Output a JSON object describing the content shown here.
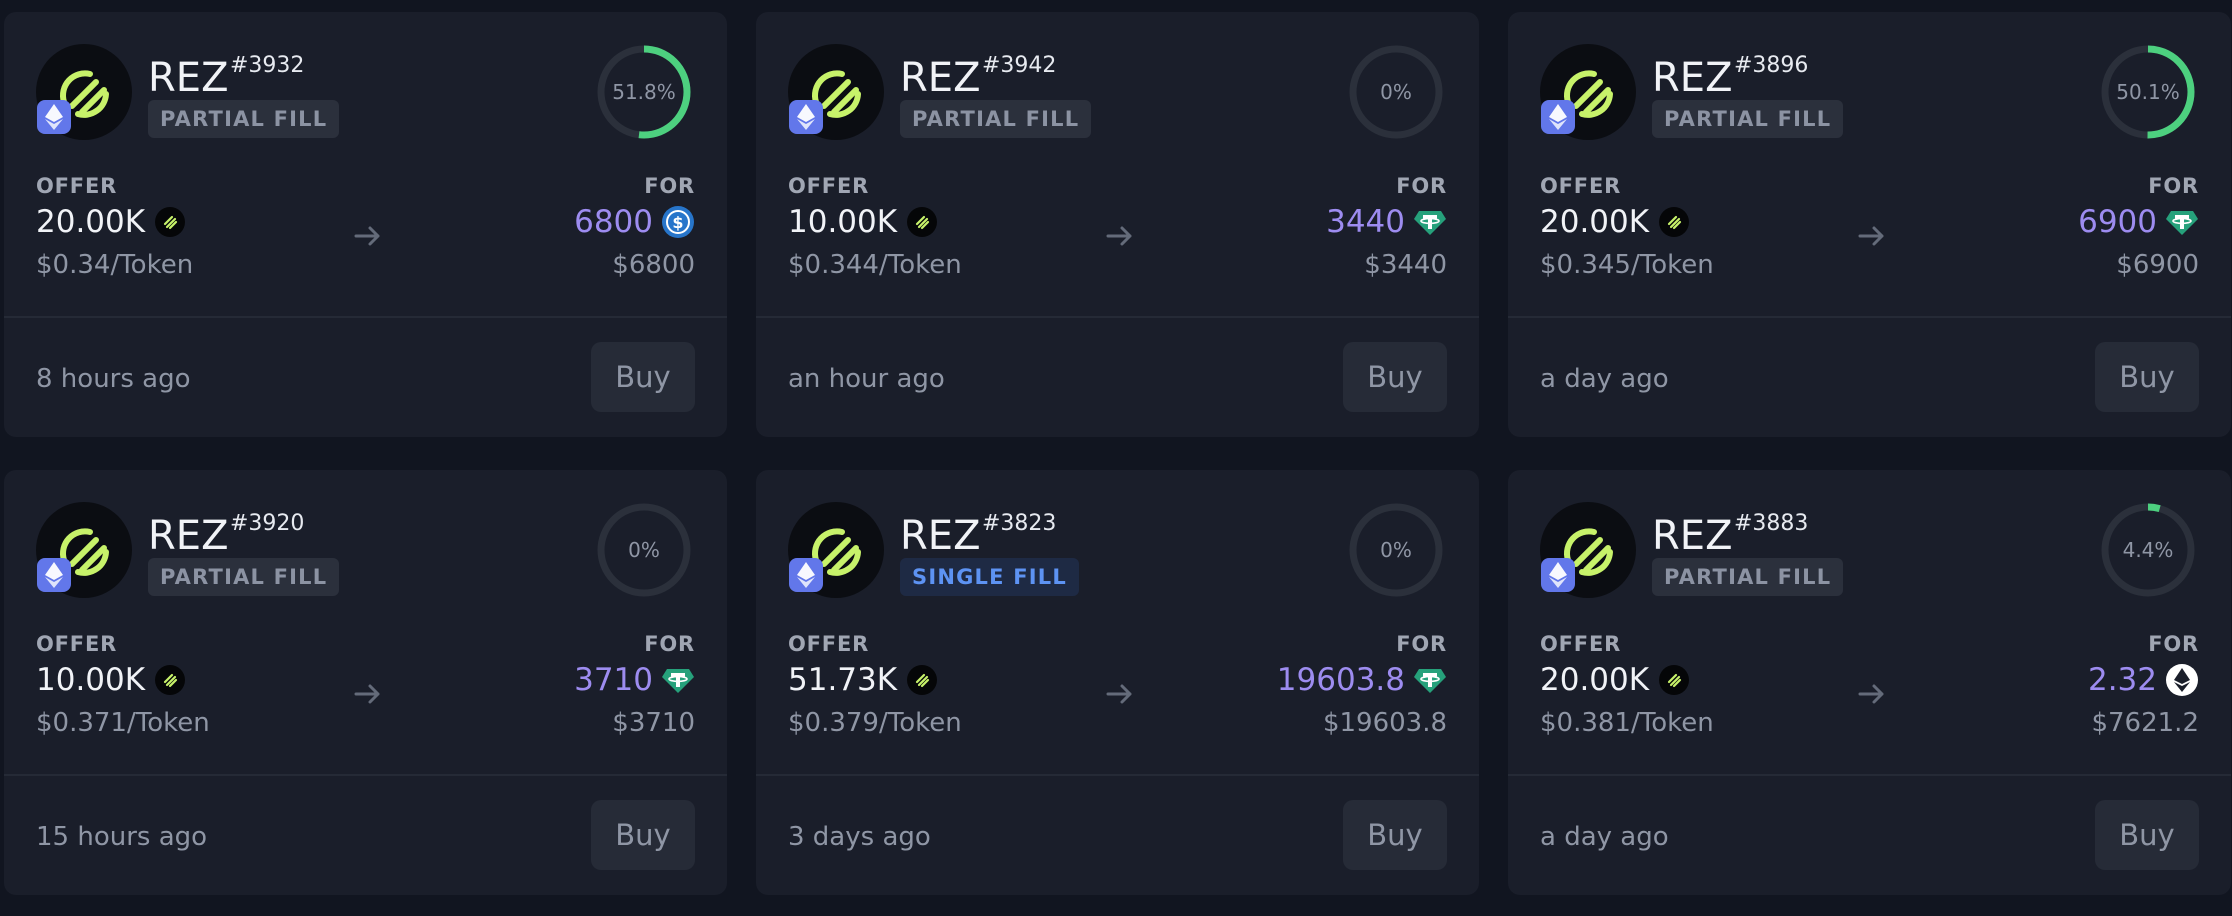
{
  "colors": {
    "background": "#111520",
    "card": "#1a1e2a",
    "accent_price": "#9d8cf0",
    "progress": "#4dd07f",
    "ring_track": "#2b303b",
    "rez_brand": "#c7f26a",
    "eth_chain": "#6277ea",
    "usdc": "#2775ca",
    "usdt": "#26a17b"
  },
  "labels": {
    "offer": "OFFER",
    "for": "FOR",
    "buy": "Buy",
    "per_token_suffix": "/Token"
  },
  "cards": [
    {
      "name": "REZ",
      "id": "#3932",
      "fill_type": "PARTIAL FILL",
      "fill_style": "partial",
      "progress": 51.8,
      "progress_label": "51.8%",
      "chain_icon": "ethereum-icon",
      "offer_amount": "20.00K",
      "offer_token_icon": "rez-token-icon",
      "price_per_token": "$0.34",
      "per_token_suffix": "/Token",
      "for_amount": "6800",
      "for_token": "usdc-icon",
      "for_usd": "$6800",
      "time": "8 hours ago",
      "buy_label": "Buy"
    },
    {
      "name": "REZ",
      "id": "#3942",
      "fill_type": "PARTIAL FILL",
      "fill_style": "partial",
      "progress": 0,
      "progress_label": "0%",
      "chain_icon": "ethereum-icon",
      "offer_amount": "10.00K",
      "offer_token_icon": "rez-token-icon",
      "price_per_token": "$0.344",
      "per_token_suffix": "/Token",
      "for_amount": "3440",
      "for_token": "usdt-icon",
      "for_usd": "$3440",
      "time": "an hour ago",
      "buy_label": "Buy"
    },
    {
      "name": "REZ",
      "id": "#3896",
      "fill_type": "PARTIAL FILL",
      "fill_style": "partial",
      "progress": 50.1,
      "progress_label": "50.1%",
      "chain_icon": "ethereum-icon",
      "offer_amount": "20.00K",
      "offer_token_icon": "rez-token-icon",
      "price_per_token": "$0.345",
      "per_token_suffix": "/Token",
      "for_amount": "6900",
      "for_token": "usdt-icon",
      "for_usd": "$6900",
      "time": "a day ago",
      "buy_label": "Buy"
    },
    {
      "name": "REZ",
      "id": "#3920",
      "fill_type": "PARTIAL FILL",
      "fill_style": "partial",
      "progress": 0,
      "progress_label": "0%",
      "chain_icon": "ethereum-icon",
      "offer_amount": "10.00K",
      "offer_token_icon": "rez-token-icon",
      "price_per_token": "$0.371",
      "per_token_suffix": "/Token",
      "for_amount": "3710",
      "for_token": "usdt-icon",
      "for_usd": "$3710",
      "time": "15 hours ago",
      "buy_label": "Buy"
    },
    {
      "name": "REZ",
      "id": "#3823",
      "fill_type": "SINGLE FILL",
      "fill_style": "single",
      "progress": 0,
      "progress_label": "0%",
      "chain_icon": "ethereum-icon",
      "offer_amount": "51.73K",
      "offer_token_icon": "rez-token-icon",
      "price_per_token": "$0.379",
      "per_token_suffix": "/Token",
      "for_amount": "19603.8",
      "for_token": "usdt-icon",
      "for_usd": "$19603.8",
      "time": "3 days ago",
      "buy_label": "Buy"
    },
    {
      "name": "REZ",
      "id": "#3883",
      "fill_type": "PARTIAL FILL",
      "fill_style": "partial",
      "progress": 4.4,
      "progress_label": "4.4%",
      "chain_icon": "ethereum-icon",
      "offer_amount": "20.00K",
      "offer_token_icon": "rez-token-icon",
      "price_per_token": "$0.381",
      "per_token_suffix": "/Token",
      "for_amount": "2.32",
      "for_token": "eth-icon",
      "for_usd": "$7621.2",
      "time": "a day ago",
      "buy_label": "Buy"
    }
  ]
}
